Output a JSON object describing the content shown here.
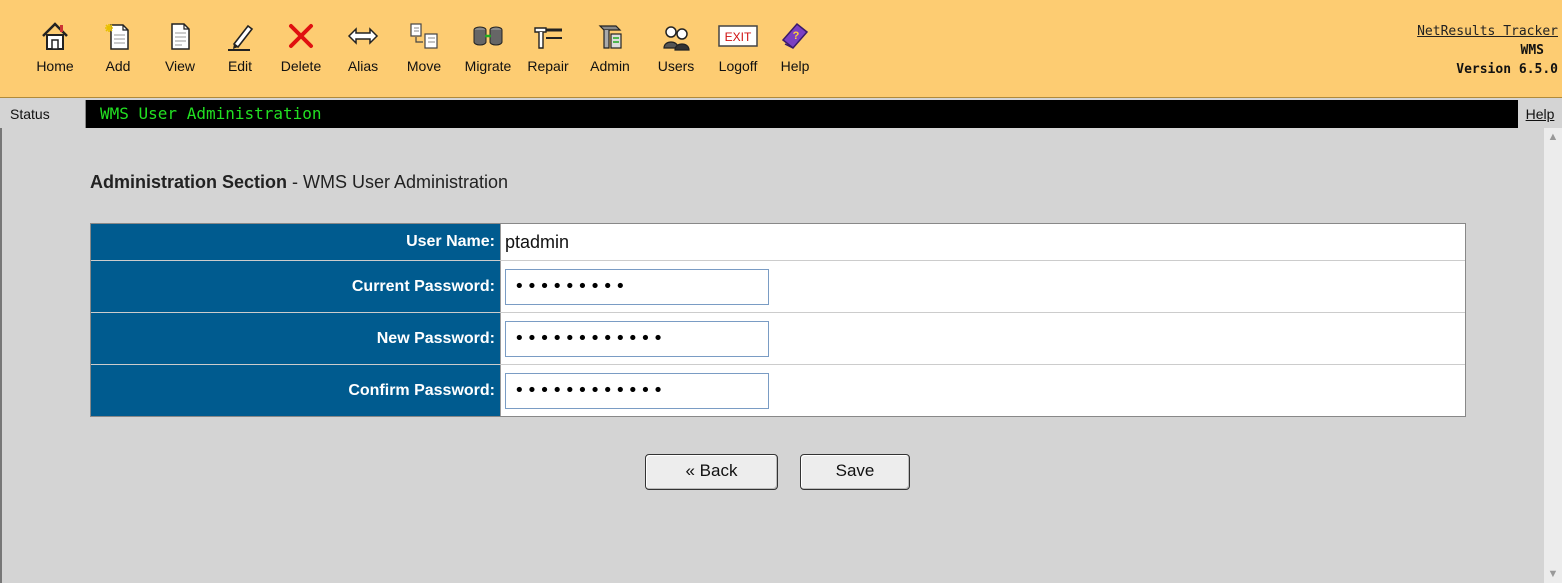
{
  "toolbar": {
    "items": [
      {
        "label": "Home",
        "icon": "home-icon"
      },
      {
        "label": "Add",
        "icon": "add-icon"
      },
      {
        "label": "View",
        "icon": "view-icon"
      },
      {
        "label": "Edit",
        "icon": "edit-icon"
      },
      {
        "label": "Delete",
        "icon": "delete-icon"
      },
      {
        "label": "Alias",
        "icon": "alias-icon"
      },
      {
        "label": "Move",
        "icon": "move-icon"
      },
      {
        "label": "Migrate",
        "icon": "migrate-icon"
      },
      {
        "label": "Repair",
        "icon": "repair-icon"
      },
      {
        "label": "Admin",
        "icon": "admin-icon"
      },
      {
        "label": "Users",
        "icon": "users-icon"
      },
      {
        "label": "Logoff",
        "icon": "logoff-icon"
      },
      {
        "label": "Help",
        "icon": "help-icon"
      }
    ],
    "brand": {
      "product": "NetResults Tracker",
      "module": "WMS",
      "version": "Version 6.5.0"
    },
    "colors": {
      "background": "#fdcc72"
    }
  },
  "status": {
    "label": "Status",
    "text": "WMS User Administration",
    "help": "Help",
    "text_color": "#22e022"
  },
  "main": {
    "title_bold": "Administration Section",
    "title_rest": " - WMS User Administration",
    "form": {
      "user_name_label": "User Name:",
      "user_name_value": "ptadmin",
      "current_password_label": "Current Password:",
      "current_password_value": "•••••••••",
      "new_password_label": "New Password:",
      "new_password_value": "••••••••••••",
      "confirm_password_label": "Confirm Password:",
      "confirm_password_value": "••••••••••••"
    },
    "buttons": {
      "back": "« Back",
      "save": "Save"
    },
    "colors": {
      "label_background": "#005b8f"
    }
  }
}
